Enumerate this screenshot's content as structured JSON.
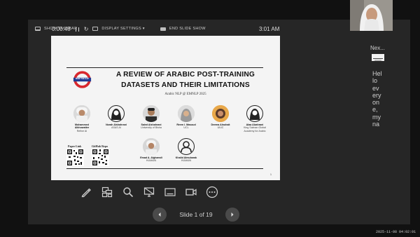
{
  "toolbar": {
    "show_taskbar": "SHOW TASKBAR",
    "display_settings": "DISPLAY SETTINGS ▾",
    "end_slide_show": "END SLIDE SHOW"
  },
  "timer": {
    "elapsed": "0:00:48",
    "clock": "3:01 AM"
  },
  "slide": {
    "logo_text": "MIND THE GAP",
    "title_line1": "A REVIEW OF ARABIC POST-TRAINING",
    "title_line2": "DATASETS AND THEIR LIMITATIONS",
    "subtitle": "Arabic NLP @ EMNLP 2025",
    "authors": [
      {
        "name": "Mohammed Alkhowaiter",
        "name1": "Mohammed",
        "name2": "Alkhowaiter",
        "affiliation": "Refine AI"
      },
      {
        "name": "Norah Alshahrani",
        "affiliation": "ASAS AI"
      },
      {
        "name": "Saied Alshahrani",
        "affiliation": "University of Bisha"
      },
      {
        "name": "Reem I. Masoud",
        "affiliation": "UCL"
      },
      {
        "name": "Deema Alnuhait",
        "affiliation": "UIUC"
      },
      {
        "name": "Alaa Alzahrani",
        "affiliation": "King Salman Global Academy for Arabic",
        "aff1": "King Salman Global",
        "aff2": "Academy for Arabic"
      },
      {
        "name": "Emad A. Alghamdi",
        "affiliation": "HUMAIN"
      },
      {
        "name": "Khalid Almubarak",
        "affiliation": "HUMAIN"
      }
    ],
    "paper_link": "Paper Link",
    "github_repo": "GitHub Repo",
    "page_number": "1"
  },
  "navigation": {
    "slide_counter": "Slide 1 of 19"
  },
  "next_panel": {
    "label": "Nex...",
    "notes": "Hello everyone, my na"
  },
  "timestamp": "2025-11-08 04:02:01",
  "colors": {
    "accent_red": "#d8282e",
    "accent_blue": "#1f3a93",
    "background": "#111111",
    "panel": "#262626"
  },
  "icons": [
    "pen-icon",
    "slides-grid-icon",
    "zoom-icon",
    "pointer-screen-icon",
    "subtitles-icon",
    "camera-icon",
    "more-options-icon"
  ]
}
